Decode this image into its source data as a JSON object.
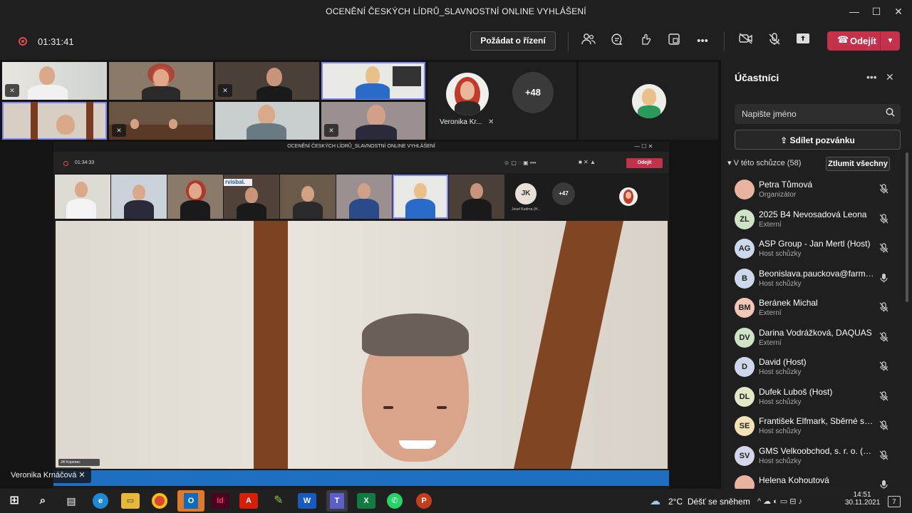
{
  "window": {
    "title": "OCENĚNÍ ČESKÝCH LÍDRŮ_SLAVNOSTNÍ ONLINE VYHLÁŠENÍ",
    "min": "—",
    "max": "☐",
    "close": "✕"
  },
  "toolbar": {
    "timer": "01:31:41",
    "request_control": "Požádat o řízení",
    "leave": "Odejít"
  },
  "gallery": {
    "spotlight_name": "Veronika Kr...",
    "overflow_count": "+48"
  },
  "stage": {
    "speaker_label": "Veronika Krnáčová"
  },
  "inner": {
    "title": "OCENĚNÍ ČESKÝCH LÍDRŮ_SLAVNOSTNÍ ONLINE VYHLÁŠENÍ",
    "timer": "01:34:33",
    "leave": "Odejít",
    "initials": "JK",
    "name": "Josef Kudrna (H...",
    "overflow": "+47",
    "speaker": "Jiří Kopenec",
    "banner": "rvisbal."
  },
  "panel": {
    "title": "Účastníci",
    "search_placeholder": "Napište jméno",
    "share_invite": "Sdílet pozvánku",
    "meeting_header": "V této schůzce (58)",
    "mute_all": "Ztlumit všechny",
    "participants": [
      {
        "initials": "",
        "name": "Petra Tůmová",
        "role": "Organizátor",
        "color": "#e8b4a0",
        "mic": "muted"
      },
      {
        "initials": "ZL",
        "name": "2025 B4 Nevosadová Leona",
        "role": "Externí",
        "color": "#cfe3c7",
        "mic": "muted"
      },
      {
        "initials": "AG",
        "name": "ASP Group - Jan Mertl (Host)",
        "role": "Host schůzky",
        "color": "#cdd9ea",
        "mic": "muted"
      },
      {
        "initials": "B",
        "name": "Beonislava.pauckova@farmak...",
        "role": "Host schůzky",
        "color": "#cdd9ea",
        "mic": "on"
      },
      {
        "initials": "BM",
        "name": "Beránek Michal",
        "role": "Externí",
        "color": "#f1c8b8",
        "mic": "muted"
      },
      {
        "initials": "DV",
        "name": "Darina Vodrážková, DAQUAS",
        "role": "Externí",
        "color": "#cfe3c7",
        "mic": "muted"
      },
      {
        "initials": "D",
        "name": "David (Host)",
        "role": "Host schůzky",
        "color": "#cdd9ea",
        "mic": "muted"
      },
      {
        "initials": "DL",
        "name": "Dufek Luboš (Host)",
        "role": "Host schůzky",
        "color": "#e3e8c7",
        "mic": "muted"
      },
      {
        "initials": "SE",
        "name": "František Elfmark, Sběrné sur...",
        "role": "Host schůzky",
        "color": "#f3e2b5",
        "mic": "muted"
      },
      {
        "initials": "SV",
        "name": "GMS Velkoobchod, s. r. o. (Ho...",
        "role": "Host schůzky",
        "color": "#d6d6ea",
        "mic": "muted"
      },
      {
        "initials": "",
        "name": "Helena Kohoutová",
        "role": "",
        "color": "#e8b4a0",
        "mic": "on"
      }
    ]
  },
  "taskbar": {
    "weather_temp": "2°C",
    "weather_text": "Déšť se sněhem",
    "time": "14:51",
    "date": "30.11.2021",
    "notif": "7"
  }
}
